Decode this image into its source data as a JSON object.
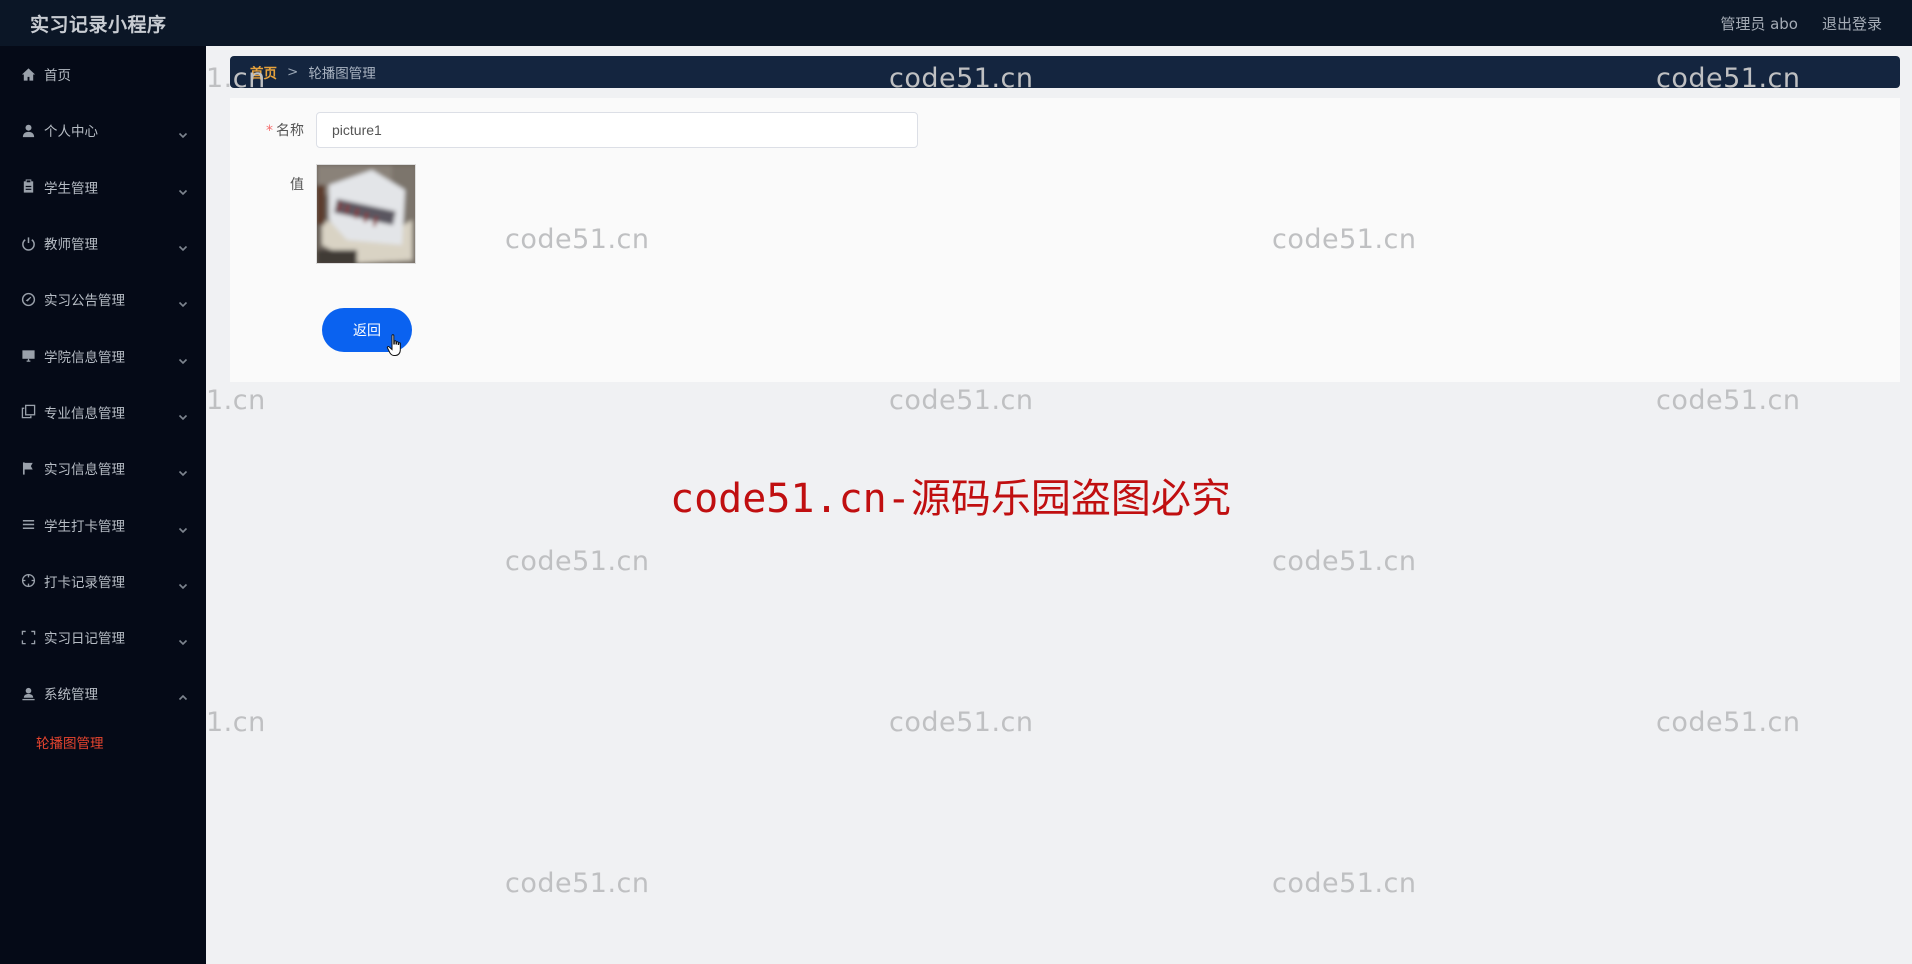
{
  "header": {
    "app_title": "实习记录小程序",
    "user_label": "管理员 abo",
    "logout_label": "退出登录"
  },
  "sidebar": {
    "items": [
      {
        "label": "首页",
        "icon": "home-icon",
        "expandable": false
      },
      {
        "label": "个人中心",
        "icon": "user-icon",
        "expandable": true,
        "expanded": false
      },
      {
        "label": "学生管理",
        "icon": "clipboard-icon",
        "expandable": true,
        "expanded": false
      },
      {
        "label": "教师管理",
        "icon": "power-icon",
        "expandable": true,
        "expanded": false
      },
      {
        "label": "实习公告管理",
        "icon": "compass-icon",
        "expandable": true,
        "expanded": false
      },
      {
        "label": "学院信息管理",
        "icon": "monitor-icon",
        "expandable": true,
        "expanded": false
      },
      {
        "label": "专业信息管理",
        "icon": "copy-icon",
        "expandable": true,
        "expanded": false
      },
      {
        "label": "实习信息管理",
        "icon": "flag-icon",
        "expandable": true,
        "expanded": false
      },
      {
        "label": "学生打卡管理",
        "icon": "list-icon",
        "expandable": true,
        "expanded": false
      },
      {
        "label": "打卡记录管理",
        "icon": "crosshair-icon",
        "expandable": true,
        "expanded": false
      },
      {
        "label": "实习日记管理",
        "icon": "fullscreen-icon",
        "expandable": true,
        "expanded": false
      },
      {
        "label": "系统管理",
        "icon": "user-icon",
        "expandable": true,
        "expanded": true
      }
    ],
    "sub_items": [
      {
        "label": "轮播图管理",
        "active": true,
        "active_color": "#e8452f"
      }
    ]
  },
  "breadcrumb": {
    "home": "首页",
    "separator": ">",
    "current": "轮播图管理"
  },
  "form": {
    "name_label": "名称",
    "name_required_mark": "*",
    "name_value": "picture1",
    "value_label": "值",
    "image_alt": "picture1 thumbnail",
    "back_button": "返回"
  },
  "watermarks": {
    "small_text": "code51.cn",
    "partial_text": "1.cn",
    "big_text": "code51.cn-源码乐园盗图必究"
  },
  "colors": {
    "topbar_bg": "#0b1626",
    "sidebar_bg": "#050a17",
    "breadcrumb_bg": "#14253f",
    "breadcrumb_home": "#e6a23c",
    "primary_button": "#0a62f0",
    "watermark_big": "#c00f10"
  }
}
